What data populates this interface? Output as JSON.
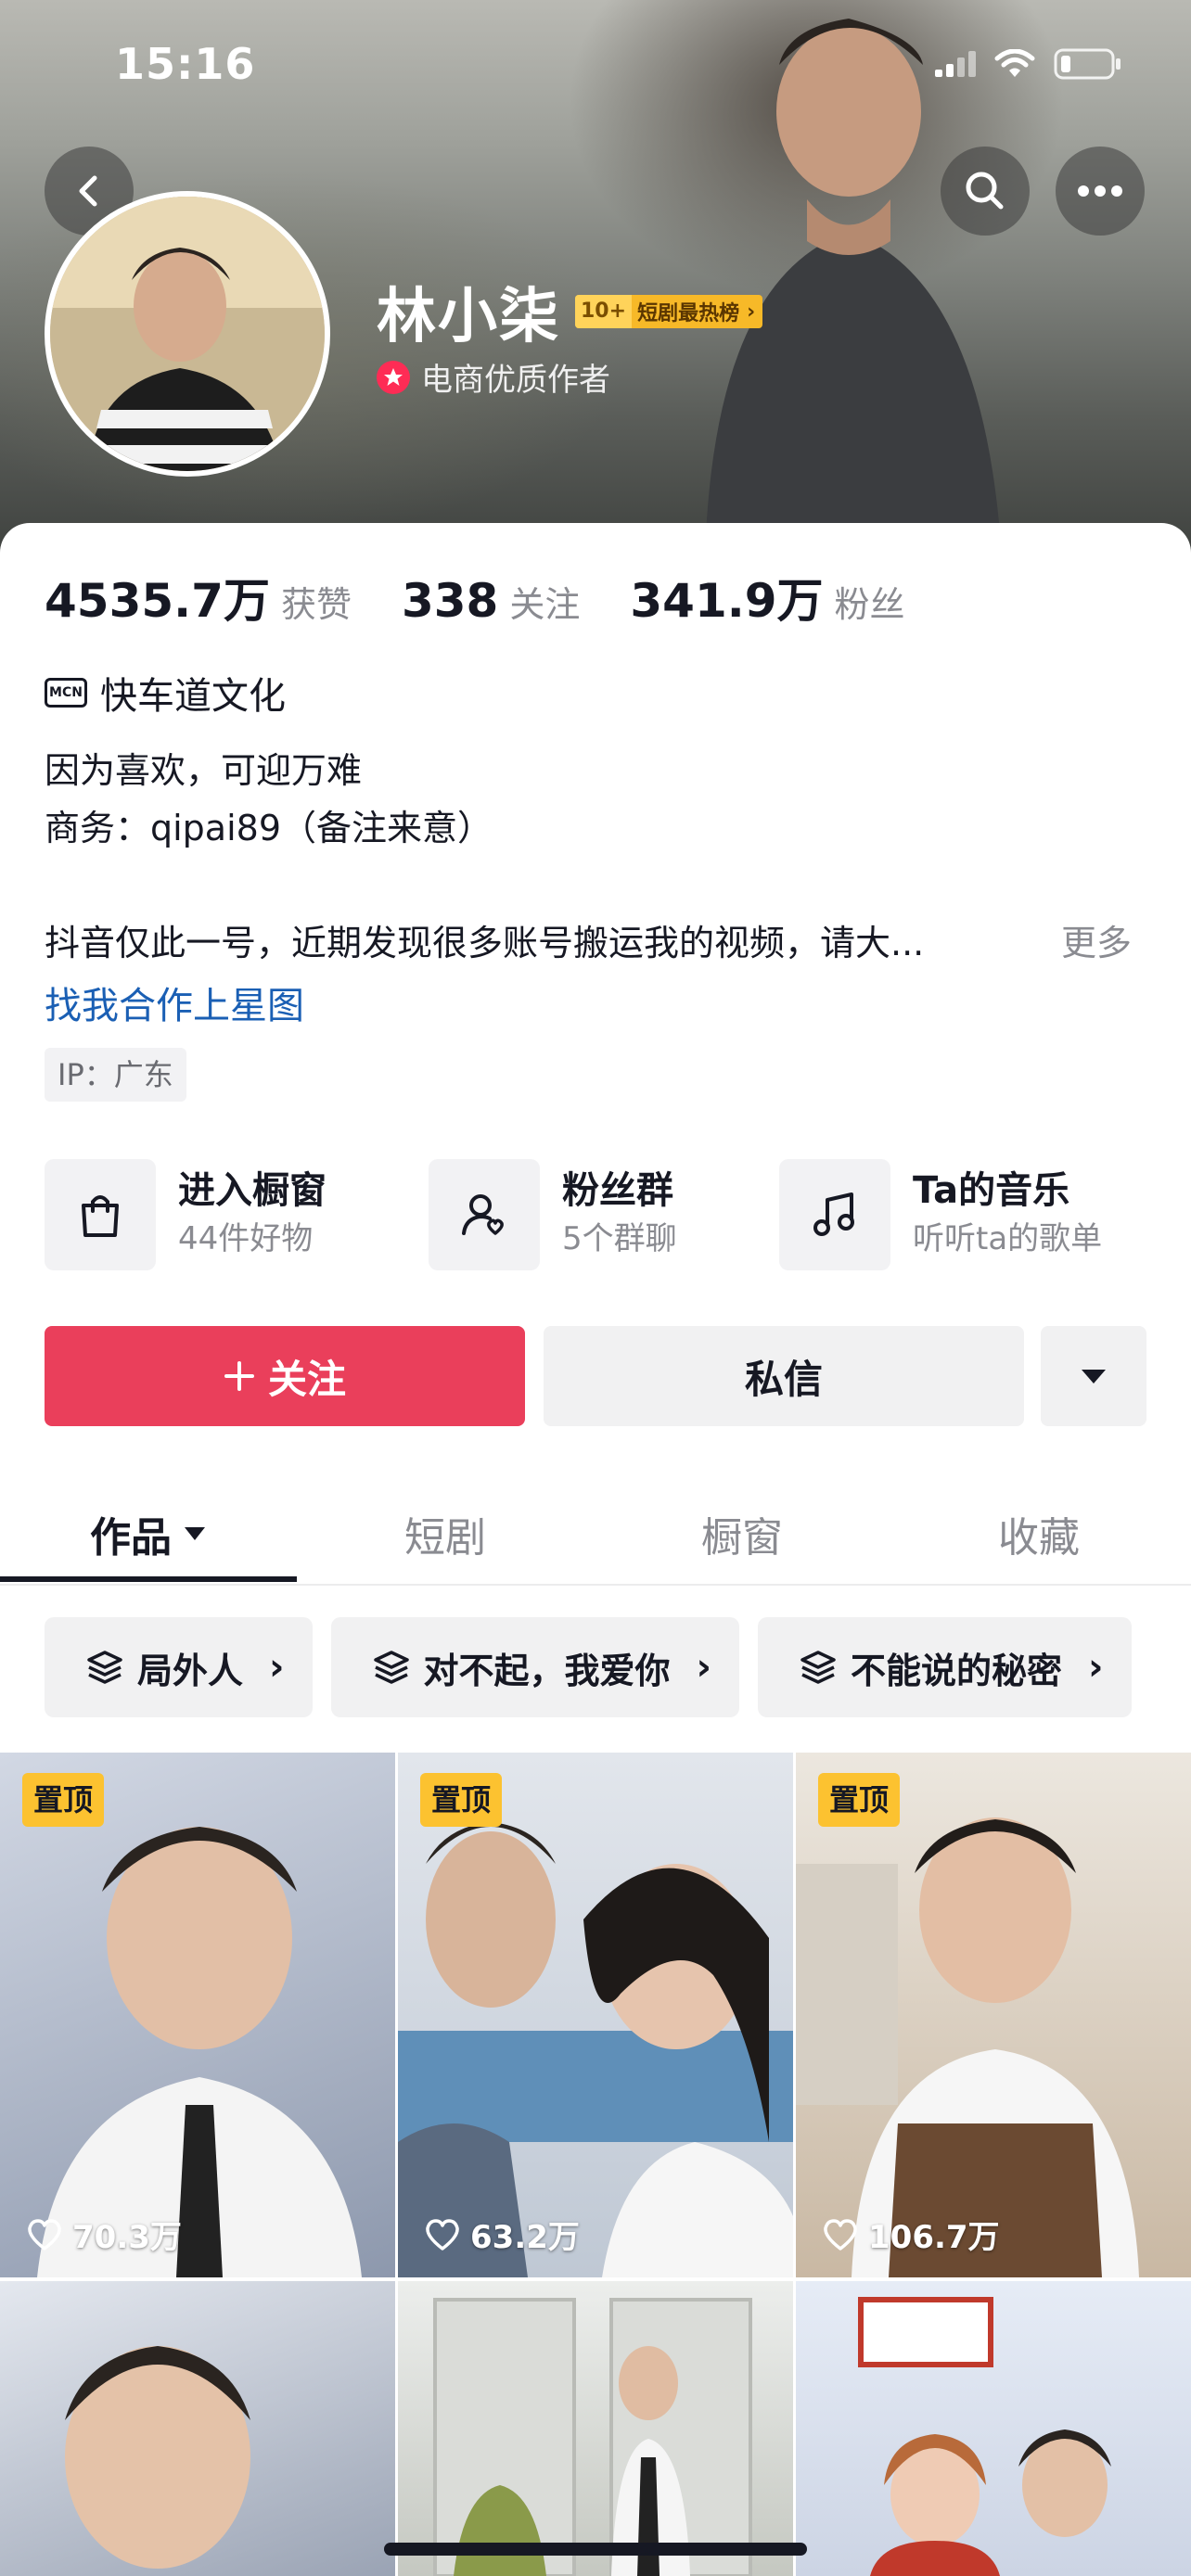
{
  "status_bar": {
    "time": "15:16"
  },
  "profile": {
    "name": "林小柒",
    "rank_badge": {
      "number": "10+",
      "label": "短剧最热榜"
    },
    "certification": "电商优质作者"
  },
  "stats": [
    {
      "value": "4535.7万",
      "label": "获赞"
    },
    {
      "value": "338",
      "label": "关注"
    },
    {
      "value": "341.9万",
      "label": "粉丝"
    }
  ],
  "mcn": {
    "icon_label": "MCN",
    "name": "快车道文化"
  },
  "bio": {
    "line1": "因为喜欢，可迎万难",
    "line2": "商务：qipai89（备注来意）",
    "line3": "抖音仅此一号，近期发现很多账号搬运我的视频，请大...",
    "more": "更多",
    "link": "找我合作上星图"
  },
  "ip_tag": "IP：广东",
  "shortcuts": [
    {
      "title": "进入橱窗",
      "subtitle": "44件好物",
      "icon": "shopping-bag-icon"
    },
    {
      "title": "粉丝群",
      "subtitle": "5个群聊",
      "icon": "fan-group-icon"
    },
    {
      "title": "Ta的音乐",
      "subtitle": "听听ta的歌单",
      "icon": "music-note-icon"
    }
  ],
  "actions": {
    "follow": "关注",
    "message": "私信"
  },
  "tabs": [
    {
      "label": "作品"
    },
    {
      "label": "短剧"
    },
    {
      "label": "橱窗"
    },
    {
      "label": "收藏"
    }
  ],
  "collections": [
    {
      "label": "局外人"
    },
    {
      "label": "对不起，我爱你"
    },
    {
      "label": "不能说的秘密"
    }
  ],
  "videos": [
    {
      "pinned": "置顶",
      "likes": "70.3万",
      "colors": [
        "#c9d1e0",
        "#8d98ad"
      ]
    },
    {
      "pinned": "置顶",
      "likes": "63.2万",
      "colors": [
        "#d8dde6",
        "#5f8fb8"
      ]
    },
    {
      "pinned": "置顶",
      "likes": "106.7万",
      "colors": [
        "#e9e3da",
        "#8b6a4e"
      ]
    },
    {
      "likes": "",
      "colors": [
        "#dfe3ea",
        "#9aa3b4"
      ]
    },
    {
      "likes": "",
      "colors": [
        "#e4e6e3",
        "#b9bcb5"
      ]
    },
    {
      "likes": "",
      "colors": [
        "#dfe6f1",
        "#c8d0e0"
      ]
    }
  ],
  "colors": {
    "accent": "#ea3f5b",
    "badge": "#fcc230",
    "link": "#1a5fb4"
  }
}
